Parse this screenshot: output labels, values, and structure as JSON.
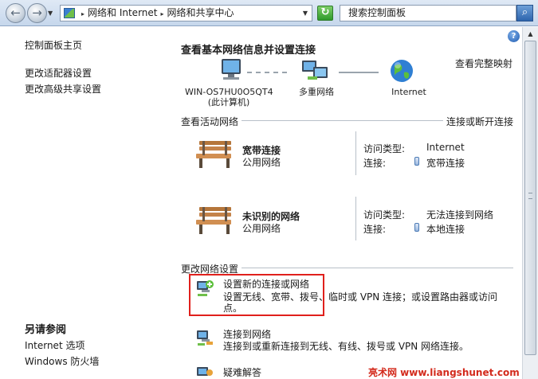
{
  "address_bar": {
    "crumbs": [
      "网络和 Internet",
      "网络和共享中心"
    ],
    "search_placeholder": "搜索控制面板"
  },
  "left_pane": {
    "links": [
      "控制面板主页",
      "更改适配器设置",
      "更改高级共享设置"
    ],
    "see_also_heading": "另请参阅",
    "see_also_links": [
      "Internet 选项",
      "Windows 防火墙"
    ]
  },
  "main": {
    "title": "查看基本网络信息并设置连接",
    "full_map_link": "查看完整映射",
    "map_nodes": [
      {
        "label_line1": "WIN-OS7HU0O5QT4",
        "label_line2": "(此计算机)"
      },
      {
        "label_line1": "多重网络",
        "label_line2": ""
      },
      {
        "label_line1": "Internet",
        "label_line2": ""
      }
    ],
    "active_networks_heading": "查看活动网络",
    "connect_disconnect_link": "连接或断开连接",
    "networks": [
      {
        "name": "宽带连接",
        "category": "公用网络",
        "access_label": "访问类型:",
        "access_value": "Internet",
        "conn_label": "连接:",
        "conn_value": "宽带连接"
      },
      {
        "name": "未识别的网络",
        "category": "公用网络",
        "access_label": "访问类型:",
        "access_value": "无法连接到网络",
        "conn_label": "连接:",
        "conn_value": "本地连接"
      }
    ],
    "change_settings_heading": "更改网络设置",
    "tasks": [
      {
        "title": "设置新的连接或网络",
        "desc": "设置无线、宽带、拨号、临时或 VPN 连接；或设置路由器或访问点。"
      },
      {
        "title": "连接到网络",
        "desc": "连接到或重新连接到无线、有线、拨号或 VPN 网络连接。"
      },
      {
        "title": "疑难解答",
        "desc": ""
      }
    ]
  },
  "watermark": "亮术网 www.liangshunet.com",
  "colors": {
    "highlight_border": "#e0201c",
    "watermark": "#d32a1c"
  }
}
